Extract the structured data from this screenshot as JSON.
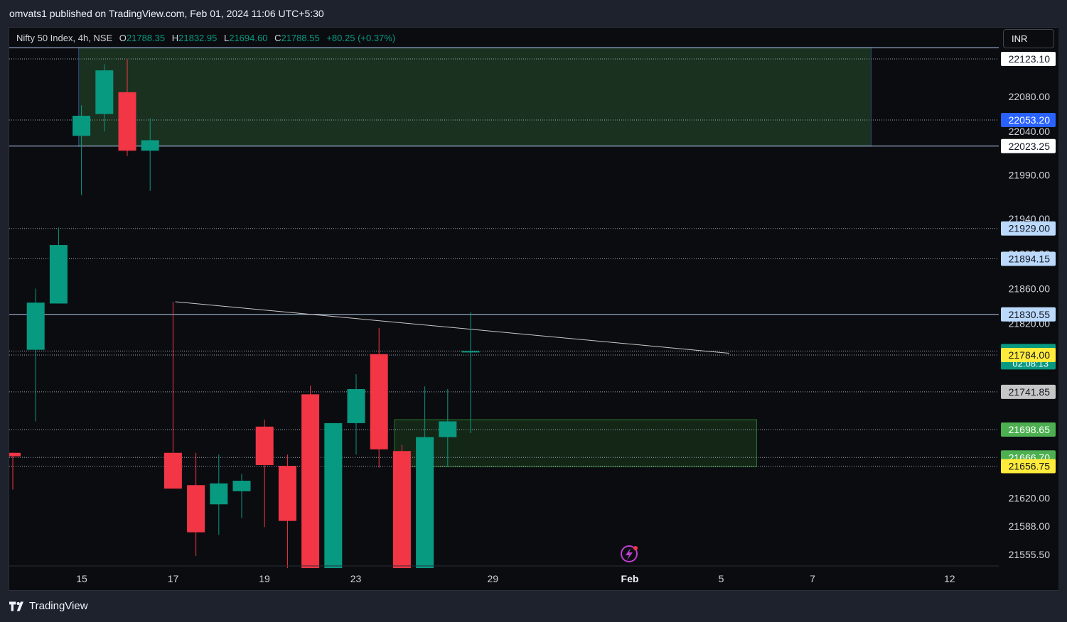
{
  "header": {
    "published": "omvats1 published on TradingView.com, Feb 01, 2024 11:06 UTC+5:30"
  },
  "legend": {
    "symbol": "Nifty 50 Index, 4h, NSE",
    "o_label": "O",
    "o": "21788.35",
    "h_label": "H",
    "h": "21832.95",
    "l_label": "L",
    "l": "21694.60",
    "c_label": "C",
    "c": "21788.55",
    "change": "+80.25 (+0.37%)"
  },
  "currency": "INR",
  "footer": {
    "brand": "TradingView"
  },
  "colors": {
    "up": "#089981",
    "down": "#f23645",
    "zone_fill": "#1b3320",
    "zone_border": "#2e4a8c",
    "zone2_border": "#2e7d32",
    "trendline": "#c8c8c8",
    "hline": "#b2c7e8"
  },
  "chart_data": {
    "type": "candlestick",
    "ylim": [
      21530,
      22150
    ],
    "x_ticks": [
      {
        "label": "15",
        "t": 15
      },
      {
        "label": "17",
        "t": 17
      },
      {
        "label": "19",
        "t": 19
      },
      {
        "label": "23",
        "t": 21
      },
      {
        "label": "29",
        "t": 24
      },
      {
        "label": "Feb",
        "t": 27
      },
      {
        "label": "5",
        "t": 29
      },
      {
        "label": "7",
        "t": 31
      },
      {
        "label": "12",
        "t": 34
      }
    ],
    "y_ticks": [
      "22080.00",
      "22040.00",
      "21990.00",
      "21940.00",
      "21900.00",
      "21860.00",
      "21820.00",
      "21620.00",
      "21588.00",
      "21555.50"
    ],
    "candles": [
      {
        "o": 21672,
        "h": 21672,
        "l": 21630,
        "c": 21668
      },
      {
        "o": 21790,
        "h": 21860,
        "l": 21708,
        "c": 21844
      },
      {
        "o": 21843,
        "h": 21930,
        "l": 21843,
        "c": 21910
      },
      {
        "o": 22035,
        "h": 22070,
        "l": 21967,
        "c": 22058
      },
      {
        "o": 22060,
        "h": 22117,
        "l": 22040,
        "c": 22110
      },
      {
        "o": 22085,
        "h": 22123,
        "l": 22012,
        "c": 22018
      },
      {
        "o": 22018,
        "h": 22055,
        "l": 21972,
        "c": 22030
      },
      {
        "o": 21672,
        "h": 21845,
        "l": 21672,
        "c": 21631
      },
      {
        "o": 21635,
        "h": 21672,
        "l": 21554,
        "c": 21581
      },
      {
        "o": 21613,
        "h": 21670,
        "l": 21578,
        "c": 21637
      },
      {
        "o": 21628,
        "h": 21648,
        "l": 21597,
        "c": 21640
      },
      {
        "o": 21702,
        "h": 21710,
        "l": 21587,
        "c": 21658
      },
      {
        "o": 21657,
        "h": 21670,
        "l": 21540,
        "c": 21594
      },
      {
        "o": 21739,
        "h": 21749,
        "l": 21540,
        "c": 21540
      },
      {
        "o": 21540,
        "h": 21706,
        "l": 21540,
        "c": 21706
      },
      {
        "o": 21706,
        "h": 21762,
        "l": 21670,
        "c": 21745
      },
      {
        "o": 21785,
        "h": 21815,
        "l": 21655,
        "c": 21676
      },
      {
        "o": 21674,
        "h": 21681,
        "l": 21540,
        "c": 21540
      },
      {
        "o": 21540,
        "h": 21748,
        "l": 21540,
        "c": 21690
      },
      {
        "o": 21690,
        "h": 21745,
        "l": 21656,
        "c": 21708
      },
      {
        "o": 21788.35,
        "h": 21832.95,
        "l": 21694.6,
        "c": 21788.55
      }
    ],
    "price_labels": [
      {
        "value": 22123.1,
        "text": "22123.10",
        "bg": "#ffffff",
        "fg": "#131722"
      },
      {
        "value": 22053.2,
        "text": "22053.20",
        "bg": "#2962ff",
        "fg": "#ffffff"
      },
      {
        "value": 22023.25,
        "text": "22023.25",
        "bg": "#ffffff",
        "fg": "#131722"
      },
      {
        "value": 21929.0,
        "text": "21929.00",
        "bg": "#bbd9fb",
        "fg": "#131722"
      },
      {
        "value": 21894.15,
        "text": "21894.15",
        "bg": "#bbd9fb",
        "fg": "#131722"
      },
      {
        "value": 21830.55,
        "text": "21830.55",
        "bg": "#bbd9fb",
        "fg": "#131722"
      },
      {
        "value": 21788.55,
        "text": "21788.55",
        "sub": "02:08:13",
        "bg": "#089981",
        "fg": "#ffffff"
      },
      {
        "value": 21784.0,
        "text": "21784.00",
        "bg": "#ffeb3b",
        "fg": "#131722"
      },
      {
        "value": 21741.85,
        "text": "21741.85",
        "bg": "#c6c6c6",
        "fg": "#131722"
      },
      {
        "value": 21698.65,
        "text": "21698.65",
        "bg": "#4caf50",
        "fg": "#ffffff"
      },
      {
        "value": 21666.7,
        "text": "21666.70",
        "bg": "#4caf50",
        "fg": "#ffffff"
      },
      {
        "value": 21656.75,
        "text": "21656.75",
        "bg": "#ffeb3b",
        "fg": "#131722"
      }
    ],
    "h_lines": [
      {
        "value": 22136,
        "style": "solid"
      },
      {
        "value": 22123.1,
        "style": "dotted"
      },
      {
        "value": 22053.2,
        "style": "dotted"
      },
      {
        "value": 22023.25,
        "style": "solid"
      },
      {
        "value": 21929.0,
        "style": "dotted"
      },
      {
        "value": 21894.15,
        "style": "dotted"
      },
      {
        "value": 21830.55,
        "style": "solid"
      },
      {
        "value": 21788.55,
        "style": "dotted"
      },
      {
        "value": 21784.0,
        "style": "dotted"
      },
      {
        "value": 21741.85,
        "style": "dotted"
      },
      {
        "value": 21698.65,
        "style": "dotted"
      },
      {
        "value": 21666.7,
        "style": "dotted"
      },
      {
        "value": 21656.75,
        "style": "dotted"
      }
    ],
    "zones": [
      {
        "from_candle": 3,
        "to_candle": 37.5,
        "top": 22136,
        "bottom": 22023.25
      },
      {
        "from_candle": 16.8,
        "to_candle": 32.5,
        "top": 21710,
        "bottom": 21656
      }
    ],
    "trendline": {
      "from": {
        "candle": 7.1,
        "value": 21845
      },
      "to": {
        "candle": 31.3,
        "value": 21786
      }
    }
  }
}
